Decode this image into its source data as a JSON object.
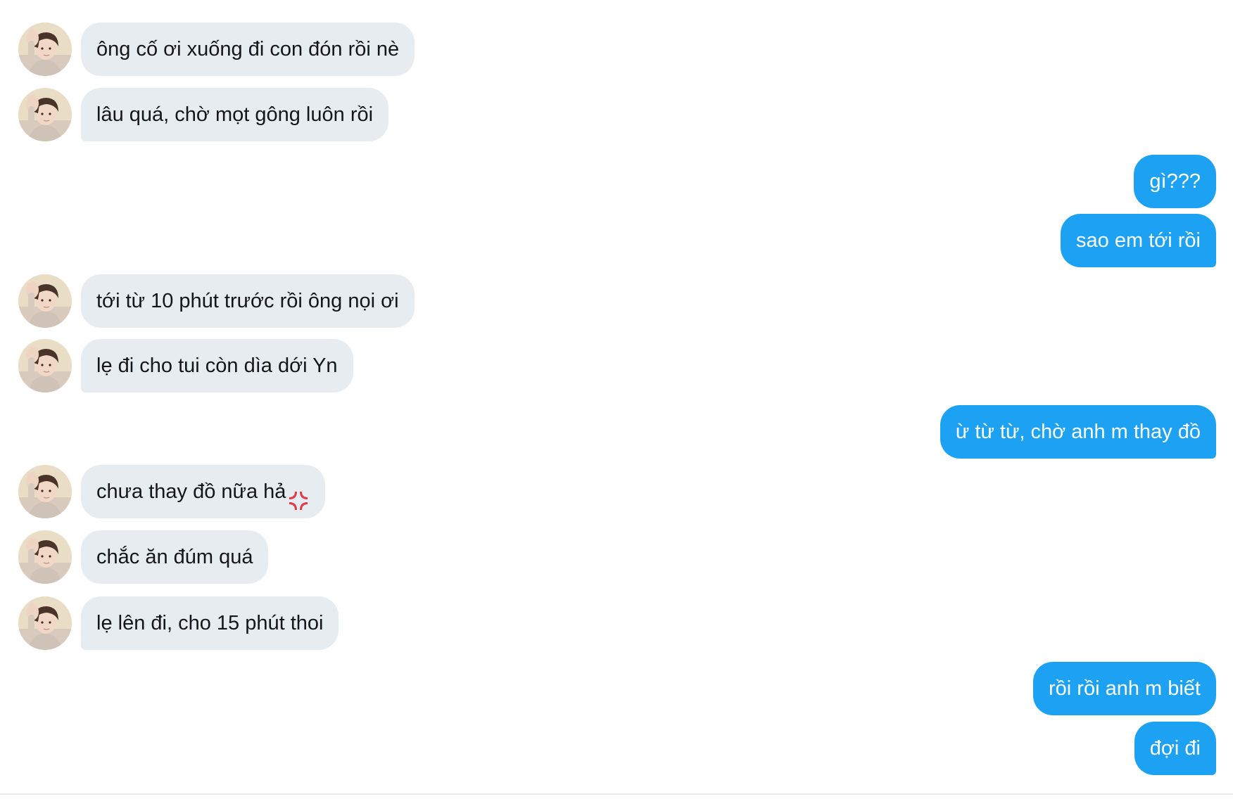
{
  "conversation": {
    "messages": [
      {
        "direction": "incoming",
        "text": "ông cố ơi xuống đi con đón rồi nè"
      },
      {
        "direction": "incoming",
        "text": "lâu quá, chờ mọt gông luôn rồi"
      },
      {
        "direction": "outgoing",
        "text": "gì???"
      },
      {
        "direction": "outgoing",
        "text": "sao em tới rồi"
      },
      {
        "direction": "incoming",
        "text": "tới từ 10 phút trước rồi ông nọi ơi"
      },
      {
        "direction": "incoming",
        "text": "lẹ đi cho tui còn dìa dới Yn"
      },
      {
        "direction": "outgoing",
        "text": "ừ từ từ, chờ anh m thay đồ"
      },
      {
        "direction": "incoming",
        "text": "chưa thay đồ nữa hả",
        "emoji": "anger-symbol-icon"
      },
      {
        "direction": "incoming",
        "text": "chắc ăn đúm quá"
      },
      {
        "direction": "incoming",
        "text": "lẹ lên đi, cho 15 phút thoi"
      },
      {
        "direction": "outgoing",
        "text": "rồi rồi anh m biết"
      },
      {
        "direction": "outgoing",
        "text": "đợi đi"
      }
    ]
  },
  "colors": {
    "background": "#ffffff",
    "incoming_bubble": "#e7ecf0",
    "incoming_text": "#14171a",
    "outgoing_bubble": "#1da1f2",
    "outgoing_text": "#ffffff",
    "divider": "#e6ecf0"
  }
}
